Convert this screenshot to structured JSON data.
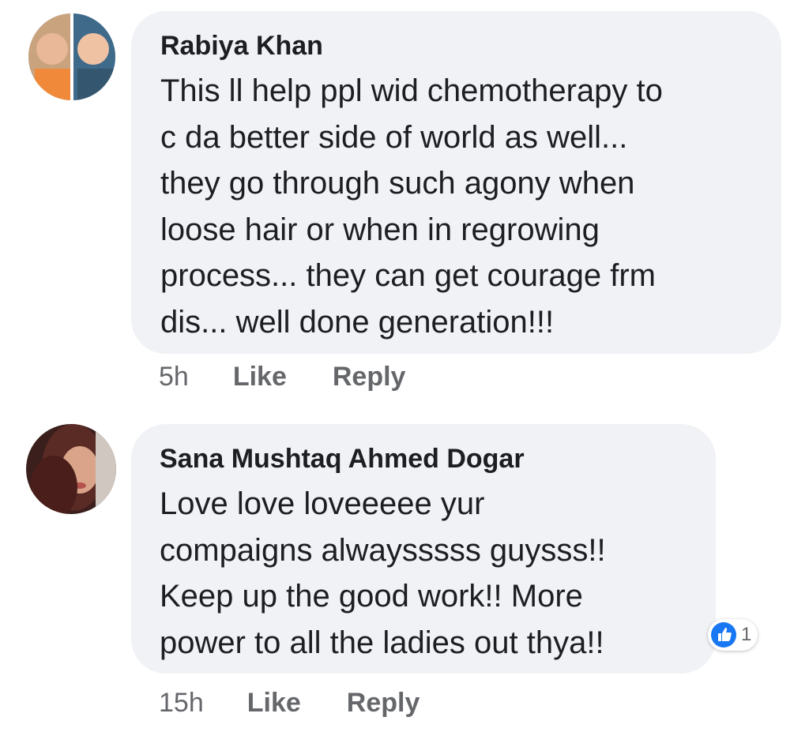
{
  "comments": [
    {
      "author": "Rabiya Khan",
      "text": "This ll help ppl wid chemotherapy to\nc da better side of world as well...\nthey go through such agony when\nloose hair or when in regrowing\nprocess... they can get courage frm\ndis... well done generation!!!",
      "time": "5h",
      "like_label": "Like",
      "reply_label": "Reply"
    },
    {
      "author": "Sana Mushtaq Ahmed Dogar",
      "text": "Love love loveeeee yur\ncompaigns alwaysssss guysss!!\nKeep up the good work!! More\npower to all the ladies out thya!!",
      "time": "15h",
      "like_label": "Like",
      "reply_label": "Reply",
      "reaction_icon": "thumbs-up-icon",
      "reaction_count": "1"
    }
  ],
  "colors": {
    "bubble": "#f0f2f5",
    "meta_text": "#65676b",
    "like_blue": "#1877f2"
  }
}
